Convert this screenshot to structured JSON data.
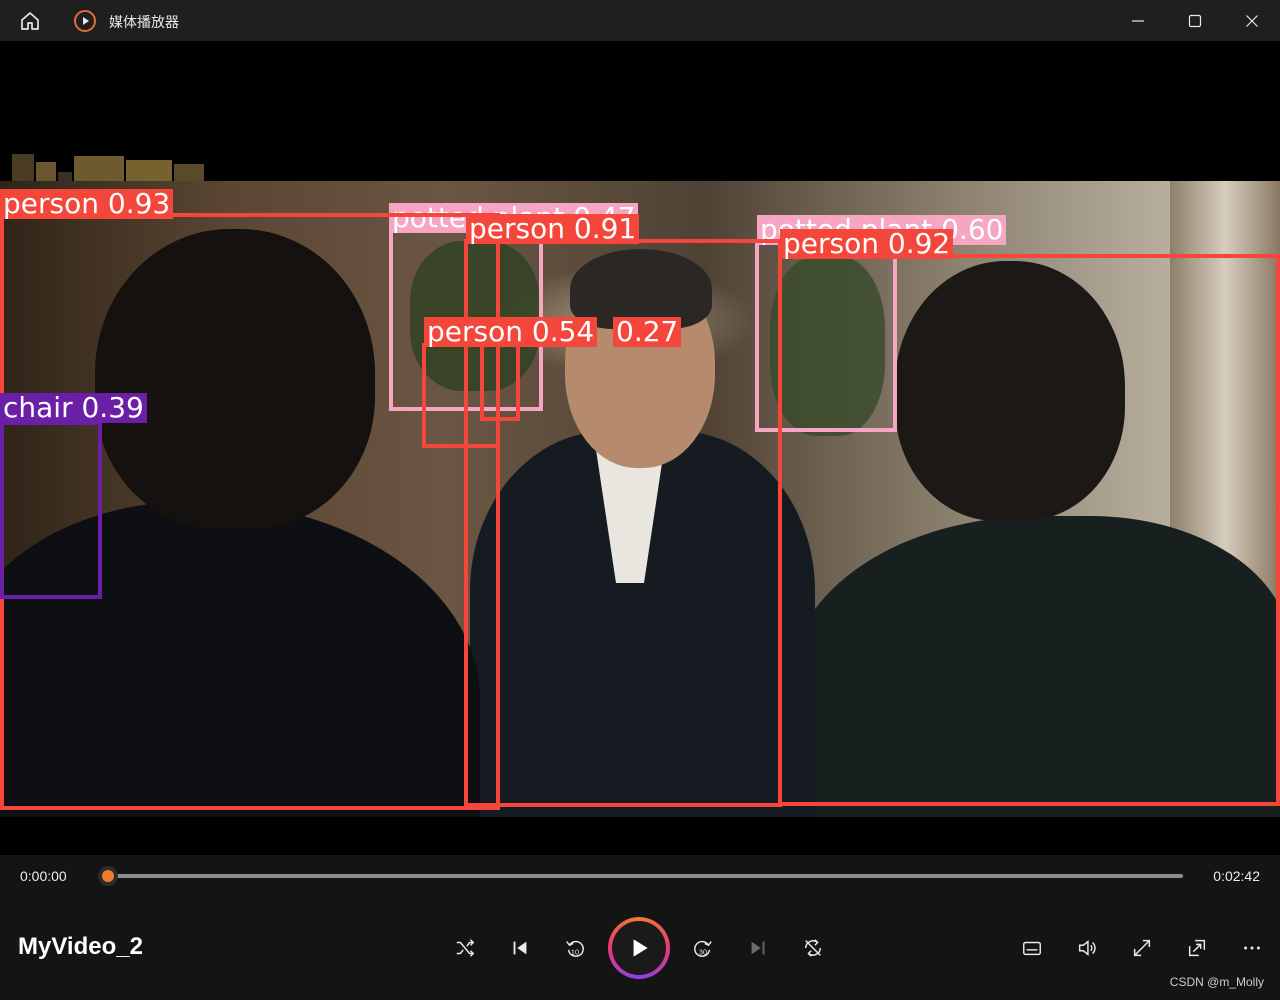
{
  "window": {
    "title": "媒体播放器",
    "icons": {
      "home": "home-icon",
      "app": "media-player-icon",
      "minimize": "minimize-icon",
      "maximize": "maximize-icon",
      "close": "close-icon"
    }
  },
  "detections": [
    {
      "label": "person 0.93",
      "class": "person",
      "confidence": 0.93,
      "color": "#f4463a"
    },
    {
      "label": "potted plant 0.47",
      "class": "potted plant",
      "confidence": 0.47,
      "color": "#f6a5c3"
    },
    {
      "label": "person 0.91",
      "class": "person",
      "confidence": 0.91,
      "color": "#f4463a"
    },
    {
      "label": "potted plant 0.60",
      "class": "potted plant",
      "confidence": 0.6,
      "color": "#f6a5c3"
    },
    {
      "label": "person 0.92",
      "class": "person",
      "confidence": 0.92,
      "color": "#f4463a"
    },
    {
      "label": "person 0.54",
      "class": "person",
      "confidence": 0.54,
      "color": "#f4463a"
    },
    {
      "label": "0.27",
      "class": "person",
      "confidence": 0.27,
      "color": "#f4463a"
    },
    {
      "label": "chair 0.39",
      "class": "chair",
      "confidence": 0.39,
      "color": "#6b1fa6"
    }
  ],
  "player": {
    "current_time": "0:00:00",
    "total_time": "0:02:42",
    "progress": 0.0,
    "video_title": "MyVideo_2",
    "accent_color": "#f07c2c",
    "controls": {
      "left": [
        "shuffle-icon",
        "previous-icon",
        "skip-back-10-icon"
      ],
      "center": "play-icon",
      "right": [
        "skip-forward-30-icon",
        "next-icon",
        "repeat-icon"
      ],
      "far_right": [
        "subtitles-icon",
        "volume-icon",
        "fullscreen-icon",
        "mini-player-icon",
        "more-icon"
      ]
    }
  },
  "watermark": "CSDN @m_Molly"
}
